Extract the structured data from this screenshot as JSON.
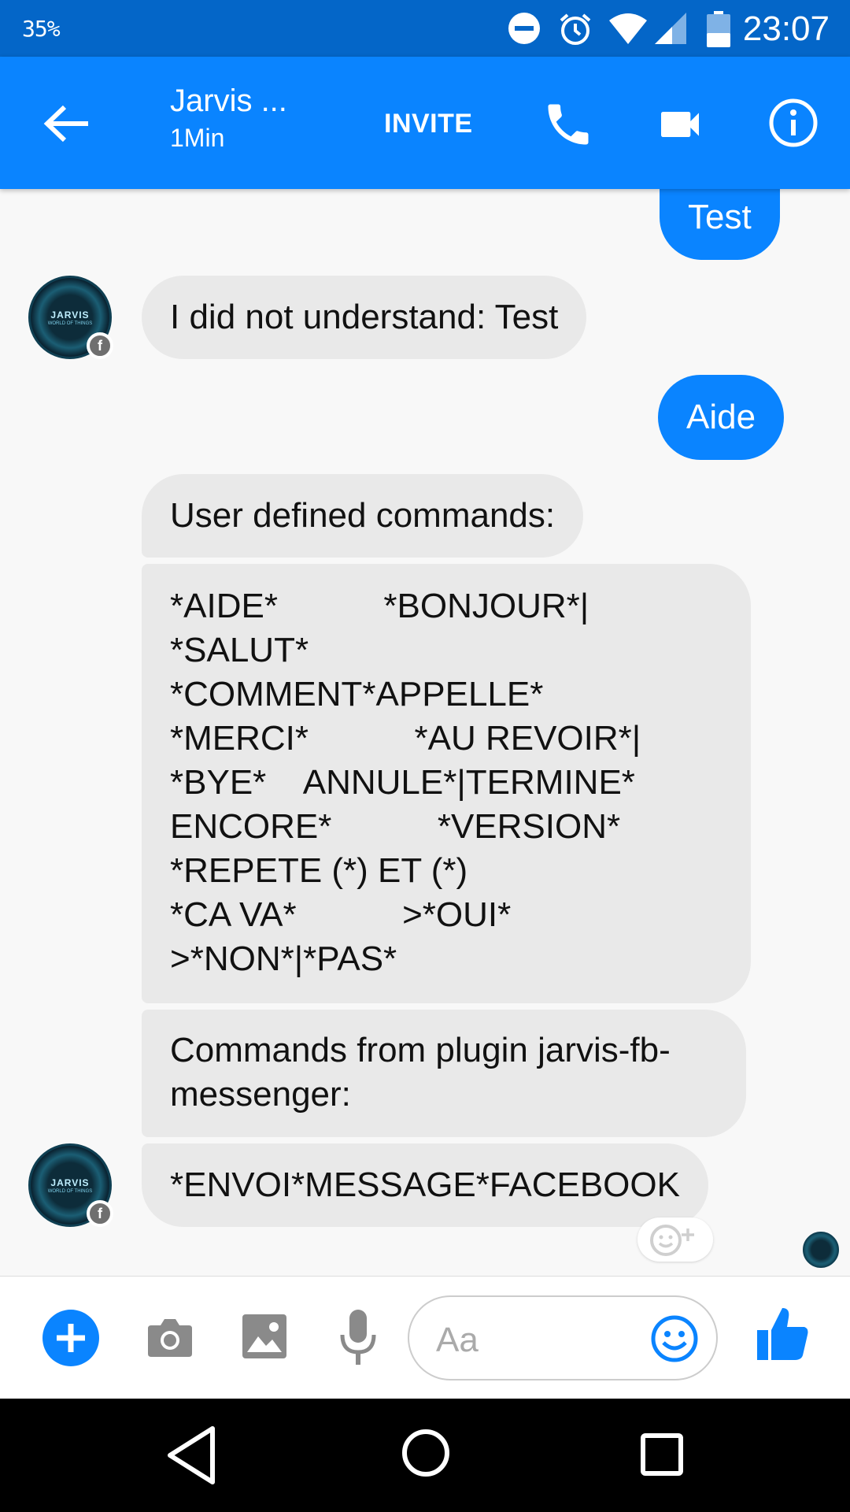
{
  "status_bar": {
    "battery_percent": "35%",
    "time": "23:07",
    "icons": [
      "do-not-disturb-icon",
      "alarm-icon",
      "wifi-icon",
      "cell-signal-icon",
      "battery-icon"
    ]
  },
  "header": {
    "title": "Jarvis ...",
    "subtitle": "1Min",
    "invite_label": "INVITE",
    "icons": [
      "back-arrow-icon",
      "phone-icon",
      "video-camera-icon",
      "info-icon"
    ]
  },
  "messages": [
    {
      "side": "out",
      "text": "Test"
    },
    {
      "side": "in",
      "text": "I did not understand: Test"
    },
    {
      "side": "out",
      "text": "Aide"
    },
    {
      "side": "in",
      "text": "User defined commands:"
    },
    {
      "side": "in",
      "lines": [
        "*AIDE*           *BONJOUR*|",
        "*SALUT*",
        "*COMMENT*APPELLE*",
        "*MERCI*           *AU REVOIR*|",
        "*BYE*    ANNULE*|TERMINE*",
        "ENCORE*           *VERSION*",
        "*REPETE (*) ET (*)",
        "*CA VA*           >*OUI*",
        ">*NON*|*PAS*"
      ]
    },
    {
      "side": "in",
      "lines": [
        "Commands from plugin jarvis-fb-",
        "messenger:"
      ]
    },
    {
      "side": "in",
      "text": "*ENVOI*MESSAGE*FACEBOOK"
    }
  ],
  "avatar": {
    "label": "JARVIS",
    "sublabel": "WORLD OF THINGS"
  },
  "composer": {
    "placeholder": "Aa",
    "icons": [
      "plus-icon",
      "camera-icon",
      "image-icon",
      "microphone-icon",
      "emoji-icon",
      "thumbs-up-icon"
    ]
  },
  "colors": {
    "accent": "#0a84ff",
    "status_bar": "#0466c8",
    "incoming_bubble": "#e9e9e9"
  }
}
